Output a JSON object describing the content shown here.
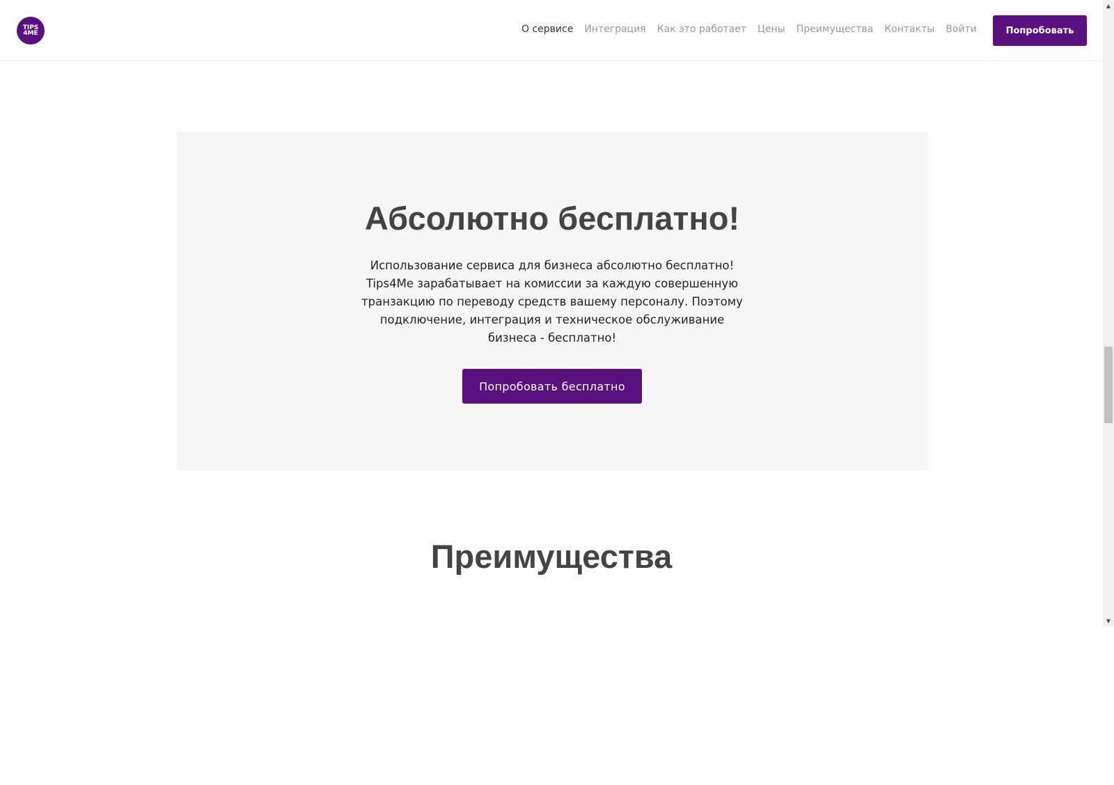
{
  "header": {
    "logo_line1": "TIPS",
    "logo_line2": "4ME",
    "nav": [
      {
        "label": "О сервисе"
      },
      {
        "label": "Интеграция"
      },
      {
        "label": "Как это работает"
      },
      {
        "label": "Цены"
      },
      {
        "label": "Преимущества"
      },
      {
        "label": "Контакты"
      },
      {
        "label": "Войти"
      }
    ],
    "cta_label": "Попробовать"
  },
  "free_section": {
    "title": "Абсолютно бесплатно!",
    "text": "Использование сервиса для бизнеса абсолютно бесплатно! Tips4Me зарабатывает на комиссии за каждую совершенную транзакцию по переводу средств вашему персоналу. Поэтому подключение, интеграция и техническое обслуживание бизнеса - бесплатно!",
    "button_label": "Попробовать бесплатно"
  },
  "advantages_section": {
    "title": "Преимущества"
  },
  "colors": {
    "brand": "#5a1180",
    "section_bg": "#f7f7f7",
    "heading": "#444444",
    "nav_inactive": "#999999",
    "nav_active": "#333333"
  },
  "scrollbar": {
    "up_icon": "arrow-up-icon",
    "down_icon": "arrow-down-icon"
  }
}
